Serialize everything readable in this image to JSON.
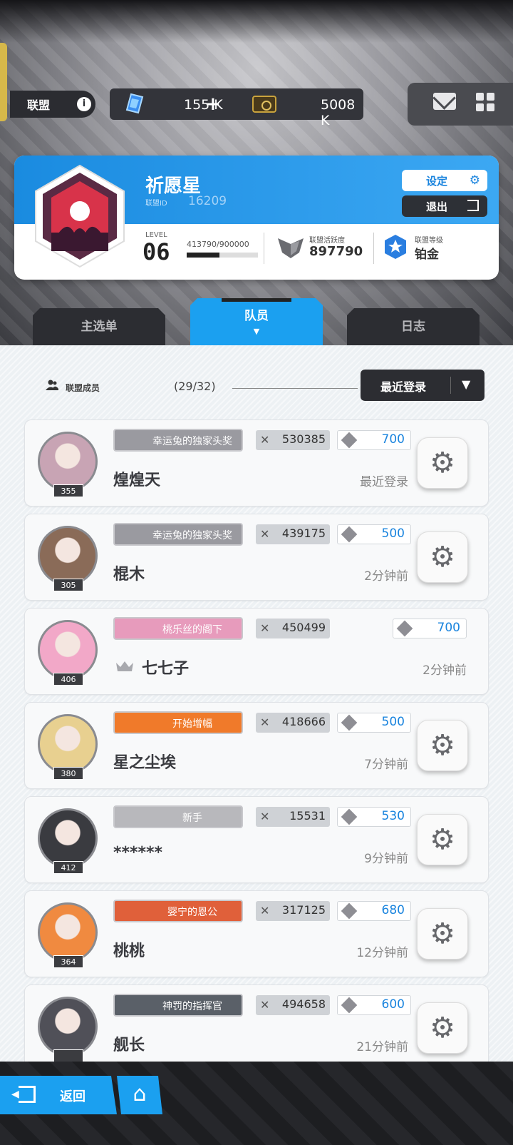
{
  "topbar": {
    "label": "联盟",
    "info_icon": "i",
    "gems": "155 K",
    "gems_plus": "+",
    "tickets": "5008 K"
  },
  "guild": {
    "name": "祈愿星",
    "id_label": "联盟ID",
    "id": "16209",
    "settings_label": "设定",
    "exit_label": "退出",
    "level_label": "LEVEL",
    "level": "06",
    "exp": "413790/900000",
    "exp_fraction": 0.46,
    "activity_label": "联盟活跃度",
    "activity": "897790",
    "rank_label": "联盟等级",
    "rank": "铂金"
  },
  "tabs": [
    {
      "label": "主选单"
    },
    {
      "label": "队员"
    },
    {
      "label": "日志"
    }
  ],
  "members_header": {
    "label": "联盟成员",
    "count": "(29/32)",
    "sort_label": "最近登录",
    "sort_arrow": "▼"
  },
  "members": [
    {
      "name": "煌煌天",
      "level": "355",
      "title": "幸运兔的独家头奖",
      "title_color": "#9a9aa0",
      "power": "530385",
      "contrib": "700",
      "time": "最近登录",
      "avatar_color": "#c8a4b4"
    },
    {
      "name": "棍木",
      "level": "305",
      "title": "幸运兔的独家头奖",
      "title_color": "#9a9aa0",
      "power": "439175",
      "contrib": "500",
      "time": "2分钟前",
      "avatar_color": "#8a6b58"
    },
    {
      "name": "七七子",
      "level": "406",
      "title": "桃乐丝的阁下",
      "title_color": "#e79bbc",
      "power": "450499",
      "contrib": "700",
      "time": "2分钟前",
      "avatar_color": "#f2a8c8"
    },
    {
      "name": "星之尘埃",
      "level": "380",
      "title": "开始增幅",
      "title_color": "#f07a2a",
      "power": "418666",
      "contrib": "500",
      "time": "7分钟前",
      "avatar_color": "#e8d090"
    },
    {
      "name": "******",
      "level": "412",
      "title": "新手",
      "title_color": "#b8b8bc",
      "power": "15531",
      "contrib": "530",
      "time": "9分钟前",
      "avatar_color": "#3a3b40"
    },
    {
      "name": "桃桃",
      "level": "364",
      "title": "婴宁的恩公",
      "title_color": "#e0603a",
      "power": "317125",
      "contrib": "680",
      "time": "12分钟前",
      "avatar_color": "#f08a40"
    },
    {
      "name": "舰长",
      "level": "",
      "title": "神罚的指挥官",
      "title_color": "#5a6068",
      "power": "494658",
      "contrib": "600",
      "time": "21分钟前",
      "avatar_color": "#505058"
    }
  ],
  "bottom": {
    "back_label": "返回",
    "home_icon": "⌂"
  },
  "icons": {
    "gear": "⚙",
    "crossed_swords": "✕"
  }
}
